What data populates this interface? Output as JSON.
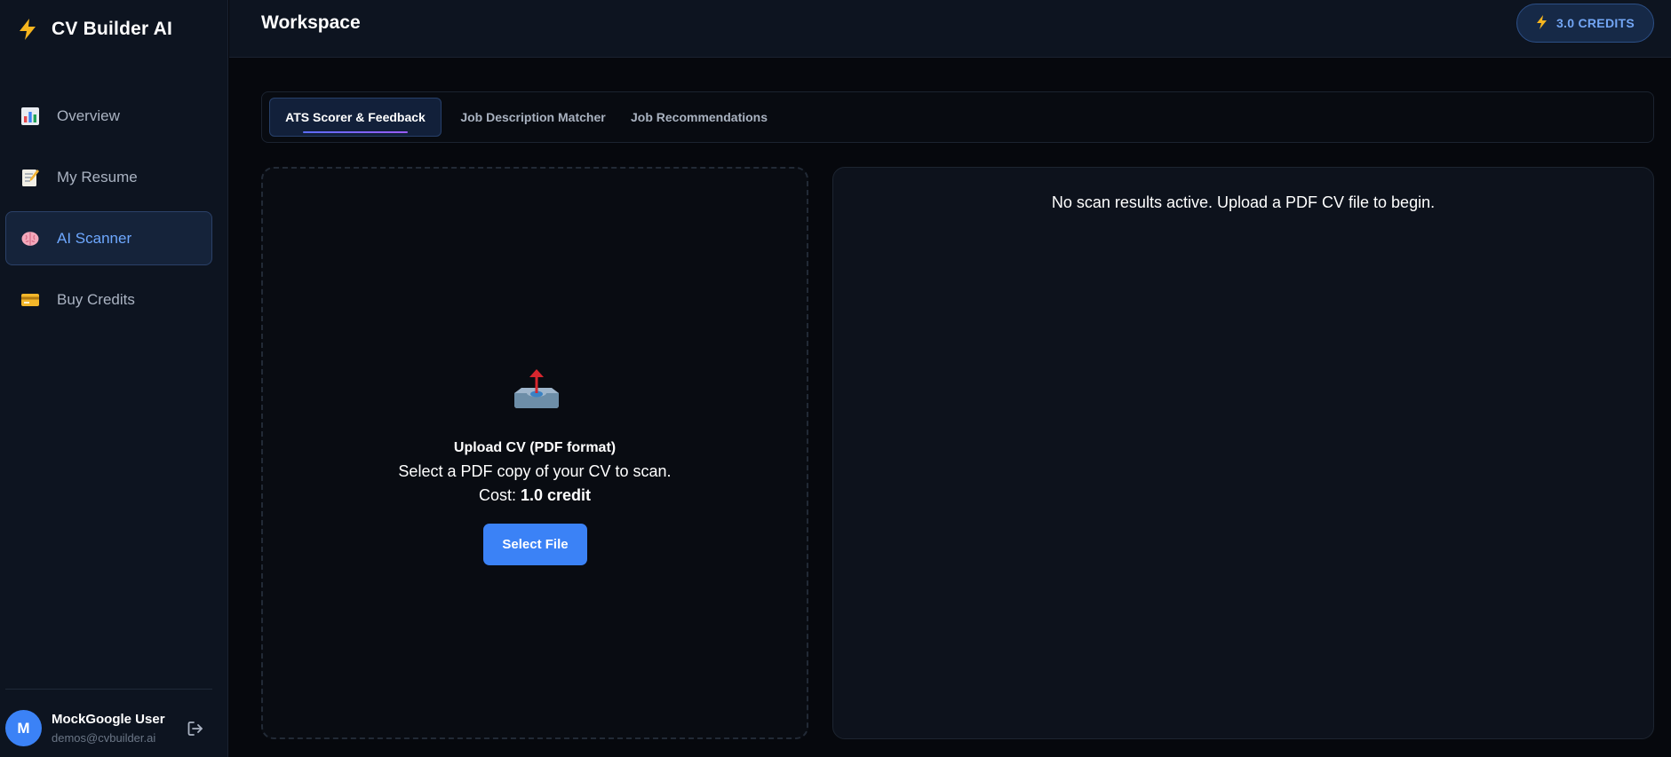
{
  "app": {
    "name": "CV Builder AI",
    "brand_icon": "lightning-icon",
    "accent": "#3b82f6"
  },
  "sidebar": {
    "items": [
      {
        "label": "Overview",
        "icon": "bar-chart-icon",
        "active": false
      },
      {
        "label": "My Resume",
        "icon": "memo-icon",
        "active": false
      },
      {
        "label": "AI Scanner",
        "icon": "brain-icon",
        "active": true
      },
      {
        "label": "Buy Credits",
        "icon": "credit-card-icon",
        "active": false
      }
    ],
    "user": {
      "initial": "M",
      "name": "MockGoogle User",
      "email": "demos@cvbuilder.ai",
      "logout_icon": "logout-icon"
    }
  },
  "header": {
    "title": "Workspace",
    "credits_label": "3.0 CREDITS",
    "credits_icon": "lightning-icon"
  },
  "tabs": [
    {
      "label": "ATS Scorer & Feedback",
      "active": true
    },
    {
      "label": "Job Description Matcher",
      "active": false
    },
    {
      "label": "Job Recommendations",
      "active": false
    }
  ],
  "upload": {
    "icon": "inbox-upload-icon",
    "title": "Upload CV (PDF format)",
    "description": "Select a PDF copy of your CV to scan.",
    "cost_prefix": "Cost: ",
    "cost_value": "1.0 credit",
    "button_label": "Select File"
  },
  "results": {
    "empty_message": "No scan results active. Upload a PDF CV file to begin."
  }
}
